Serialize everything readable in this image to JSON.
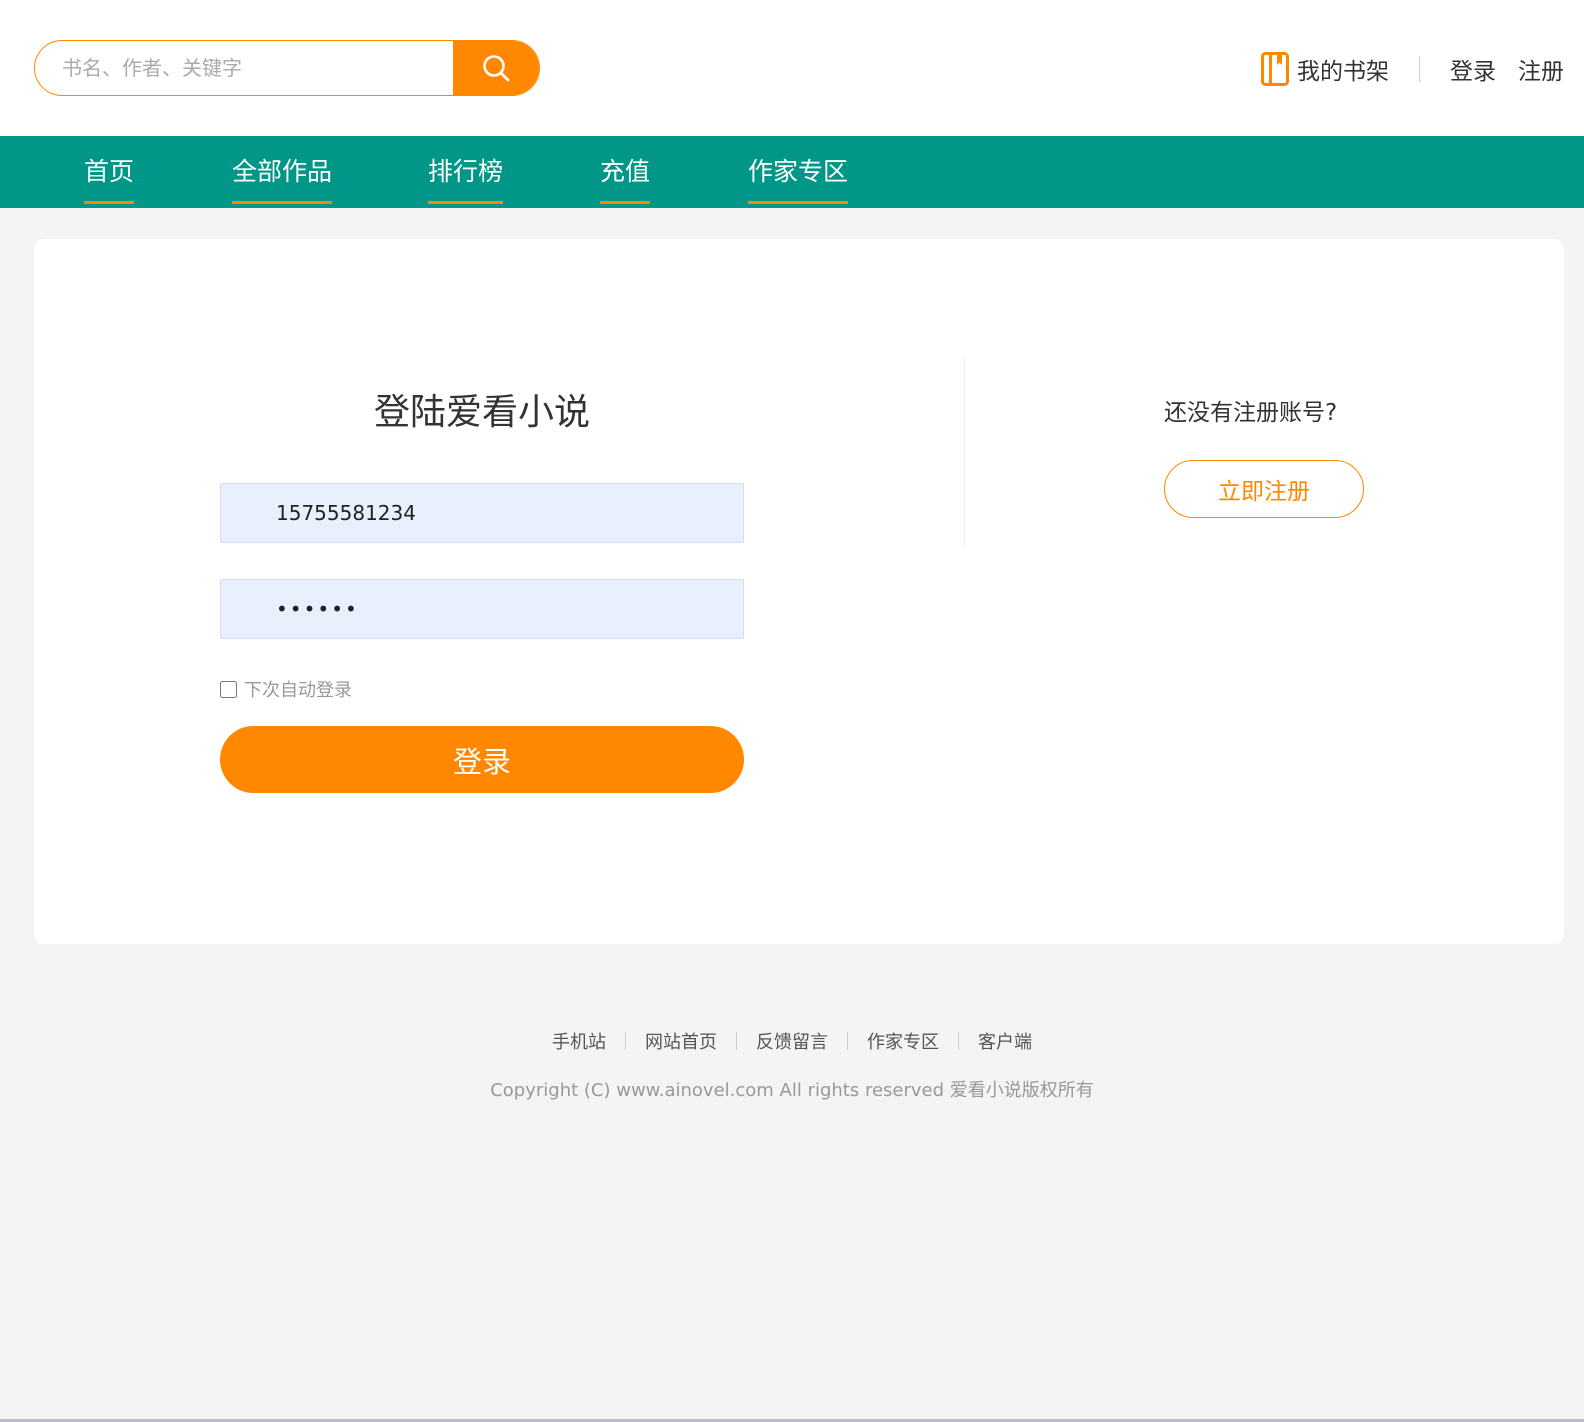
{
  "header": {
    "search": {
      "placeholder": "书名、作者、关键字",
      "value": ""
    },
    "shelf_label": "我的书架",
    "login_label": "登录",
    "register_label": "注册"
  },
  "nav": {
    "items": [
      {
        "label": "首页"
      },
      {
        "label": "全部作品"
      },
      {
        "label": "排行榜"
      },
      {
        "label": "充值"
      },
      {
        "label": "作家专区"
      }
    ]
  },
  "login": {
    "title": "登陆爱看小说",
    "username_value": "15755581234",
    "password_value": "••••••",
    "remember_label": "下次自动登录",
    "remember_checked": false,
    "submit_label": "登录"
  },
  "signup": {
    "prompt": "还没有注册账号?",
    "button_label": "立即注册"
  },
  "footer": {
    "links": [
      {
        "label": "手机站"
      },
      {
        "label": "网站首页"
      },
      {
        "label": "反馈留言"
      },
      {
        "label": "作家专区"
      },
      {
        "label": "客户端"
      }
    ],
    "copyright": "Copyright (C) www.ainovel.com All rights reserved  爱看小说版权所有"
  },
  "colors": {
    "accent": "#ff8800",
    "nav_bg": "#009688",
    "page_bg": "#f4f4f4",
    "input_bg": "#e8f0fe"
  },
  "icons": {
    "search": "search-icon",
    "shelf": "bookshelf-icon"
  }
}
